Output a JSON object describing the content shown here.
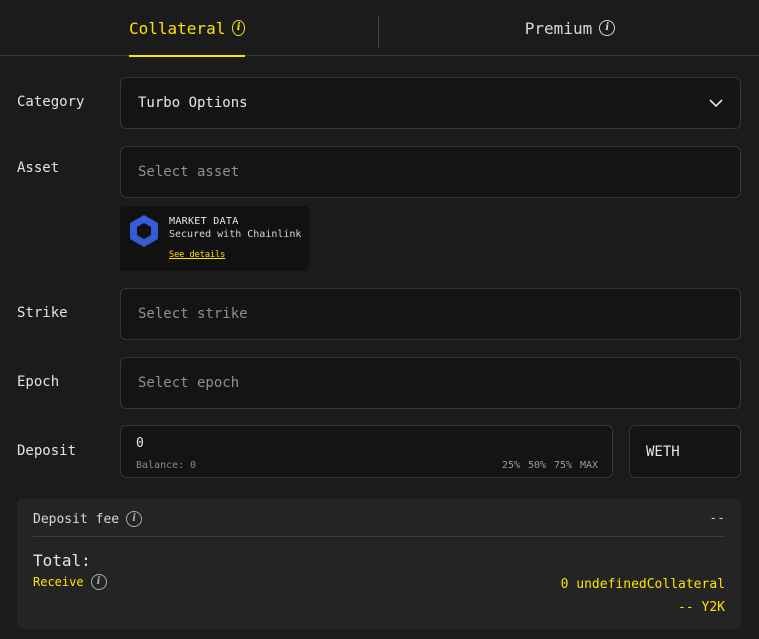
{
  "tabs": {
    "collateral": {
      "label": "Collateral",
      "active": true
    },
    "premium": {
      "label": "Premium",
      "active": false
    }
  },
  "form": {
    "category": {
      "label": "Category",
      "value": "Turbo Options"
    },
    "asset": {
      "label": "Asset",
      "placeholder": "Select asset"
    },
    "market_data": {
      "title": "MARKET DATA",
      "subtitle": "Secured with Chainlink",
      "link": "See details"
    },
    "strike": {
      "label": "Strike",
      "placeholder": "Select strike"
    },
    "epoch": {
      "label": "Epoch",
      "placeholder": "Select epoch"
    },
    "deposit": {
      "label": "Deposit",
      "value": "0",
      "balance": "Balance: 0",
      "percent_options": [
        "25%",
        "50%",
        "75%",
        "MAX"
      ],
      "token": "WETH"
    }
  },
  "summary": {
    "fee_label": "Deposit fee",
    "fee_value": "--",
    "total_label": "Total:",
    "receive_label": "Receive",
    "receive_value": "0 undefinedCollateral",
    "receive_value_2": "-- Y2K"
  },
  "colors": {
    "accent": "#ffe200",
    "background": "#1b1b1b",
    "field": "#141414",
    "chainlink": "#375bd2"
  },
  "icons": {
    "info": "info-icon",
    "chevron": "chevron-down-icon",
    "chainlink": "chainlink-icon"
  }
}
